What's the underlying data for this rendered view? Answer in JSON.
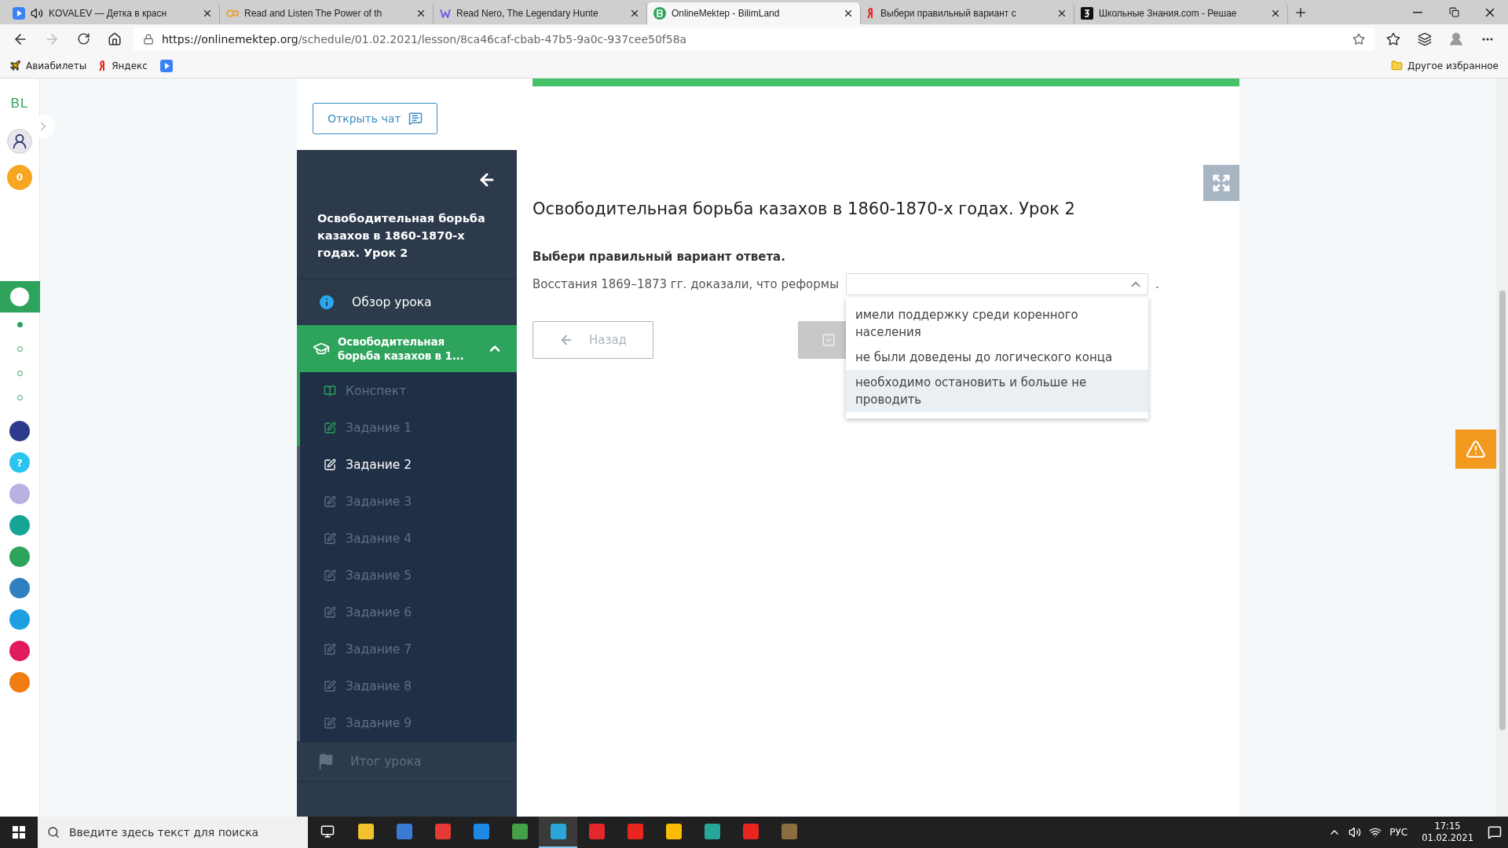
{
  "browser": {
    "tabs": [
      {
        "label": "KOVALEV — Детка в красн",
        "audio": true,
        "selected": false
      },
      {
        "label": "Read and Listen The Power of th",
        "audio": false,
        "selected": false
      },
      {
        "label": "Read Nero, The Legendary Hunte",
        "audio": false,
        "selected": false
      },
      {
        "label": "OnlineMektep - BilimLand",
        "audio": false,
        "selected": true
      },
      {
        "label": "Выбери правильный вариант с",
        "audio": false,
        "selected": false
      },
      {
        "label": "Школьные Знания.com - Решае",
        "audio": false,
        "selected": false
      }
    ],
    "address": {
      "host": "https://onlinemektep.org",
      "path": "/schedule/01.02.2021/lesson/8ca46caf-cbab-47b5-9a0c-937cee50f58a"
    },
    "bookmarks": [
      "Авиабилеты",
      "Яндекс"
    ],
    "other_bookmarks": "Другое избранное"
  },
  "rail": {
    "logo": "BL",
    "points": "0",
    "pager": [
      {
        "selected": true
      },
      {
        "selected": false
      },
      {
        "selected": false
      },
      {
        "selected": false
      }
    ],
    "apps": [
      {
        "color": "#2e3a8c"
      },
      {
        "color": "#29c4ef",
        "glyph": "?"
      },
      {
        "color": "#b8b2e3"
      },
      {
        "color": "#16a594"
      },
      {
        "color": "#2ea35c"
      },
      {
        "color": "#2f80c0"
      },
      {
        "color": "#1d9fe2"
      },
      {
        "color": "#e11a5e"
      },
      {
        "color": "#f07c12"
      }
    ]
  },
  "chat_button": "Открыть чат",
  "sidebar": {
    "title": "Освободительная борьба казахов в 1860-1870-х годах. Урок 2",
    "overview": "Обзор урока",
    "section": {
      "title": "Освободительная борьба казахов в 1...",
      "expanded": true
    },
    "items": [
      {
        "label": "Конспект",
        "kind": "notes",
        "visited": true,
        "selected": false
      },
      {
        "label": "Задание 1",
        "kind": "task",
        "visited": true,
        "selected": false
      },
      {
        "label": "Задание 2",
        "kind": "task",
        "visited": false,
        "selected": true
      },
      {
        "label": "Задание 3",
        "kind": "task",
        "visited": false,
        "selected": false
      },
      {
        "label": "Задание 4",
        "kind": "task",
        "visited": false,
        "selected": false
      },
      {
        "label": "Задание 5",
        "kind": "task",
        "visited": false,
        "selected": false
      },
      {
        "label": "Задание 6",
        "kind": "task",
        "visited": false,
        "selected": false
      },
      {
        "label": "Задание 7",
        "kind": "task",
        "visited": false,
        "selected": false
      },
      {
        "label": "Задание 8",
        "kind": "task",
        "visited": false,
        "selected": false
      },
      {
        "label": "Задание 9",
        "kind": "task",
        "visited": false,
        "selected": false
      }
    ],
    "summary": {
      "label": "Итог урока",
      "disabled": true
    }
  },
  "lesson": {
    "progress": {
      "level": 1
    },
    "title": "Освободительная борьба казахов в 1860-1870-х годах. Урок 2",
    "instruction": "Выбери правильный вариант ответа.",
    "sentence_before": "Восстания 1869–1873 гг. доказали, что реформы",
    "sentence_after": ".",
    "dropdown": {
      "expanded": true,
      "options": [
        {
          "label": "имели поддержку среди коренного населения",
          "selected": false
        },
        {
          "label": "не были доведены до логического конца",
          "selected": false
        },
        {
          "label": "необходимо остановить и больше не проводить",
          "selected": true
        }
      ]
    },
    "back_button": "Назад"
  },
  "taskbar": {
    "search_placeholder": "Введите здесь текст для поиска",
    "language": "РУС",
    "time": "17:15",
    "date": "01.02.2021",
    "apps": [
      {
        "color": "#f2c12e",
        "selected": false
      },
      {
        "color": "#3a7bd5",
        "selected": false
      },
      {
        "color": "#e53935",
        "selected": false
      },
      {
        "color": "#1e88e5",
        "selected": false
      },
      {
        "color": "#43a047",
        "selected": false
      },
      {
        "color": "#2aa6d8",
        "selected": true
      },
      {
        "color": "#e5262c",
        "selected": false
      },
      {
        "color": "#e8261f",
        "selected": false
      },
      {
        "color": "#fbbc05",
        "selected": false
      },
      {
        "color": "#27a79a",
        "selected": false
      },
      {
        "color": "#e8261f",
        "selected": false
      },
      {
        "color": "#8d6e3f",
        "selected": false
      }
    ]
  }
}
